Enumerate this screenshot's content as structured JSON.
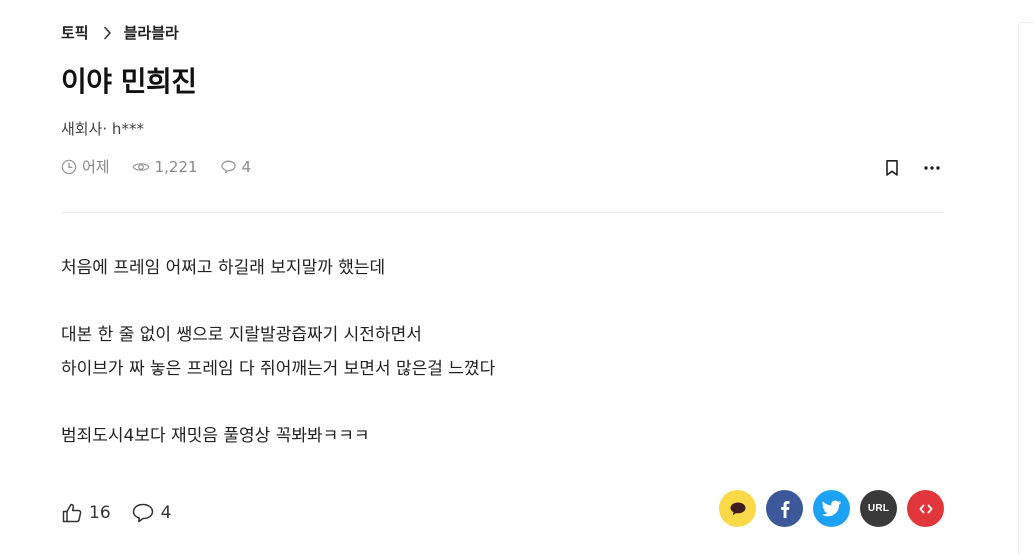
{
  "breadcrumb": {
    "topic": "토픽",
    "current": "블라블라"
  },
  "post": {
    "title": "이야 민희진",
    "author": "새회사· h***",
    "time": "어제",
    "views": "1,221",
    "comments": "4",
    "body": {
      "line1": "처음에 프레임 어쩌고 하길래 보지말까 했는데",
      "line2": "대본 한 줄 없이 쌩으로 지랄발광즙짜기 시전하면서",
      "line3": "하이브가 짜 놓은 프레임 다 쥐어깨는거 보면서 많은걸 느꼈다",
      "line4": "범죄도시4보다 재밋음 풀영상 꼭봐봐ㅋㅋㅋ"
    }
  },
  "footer": {
    "likes": "16",
    "comments": "4",
    "share": {
      "url_label": "URL",
      "colors": {
        "kakao": "#f9d948",
        "facebook": "#3b5998",
        "twitter": "#1da1f2",
        "url": "#3a3a3a",
        "embed": "#e0363c"
      }
    }
  }
}
